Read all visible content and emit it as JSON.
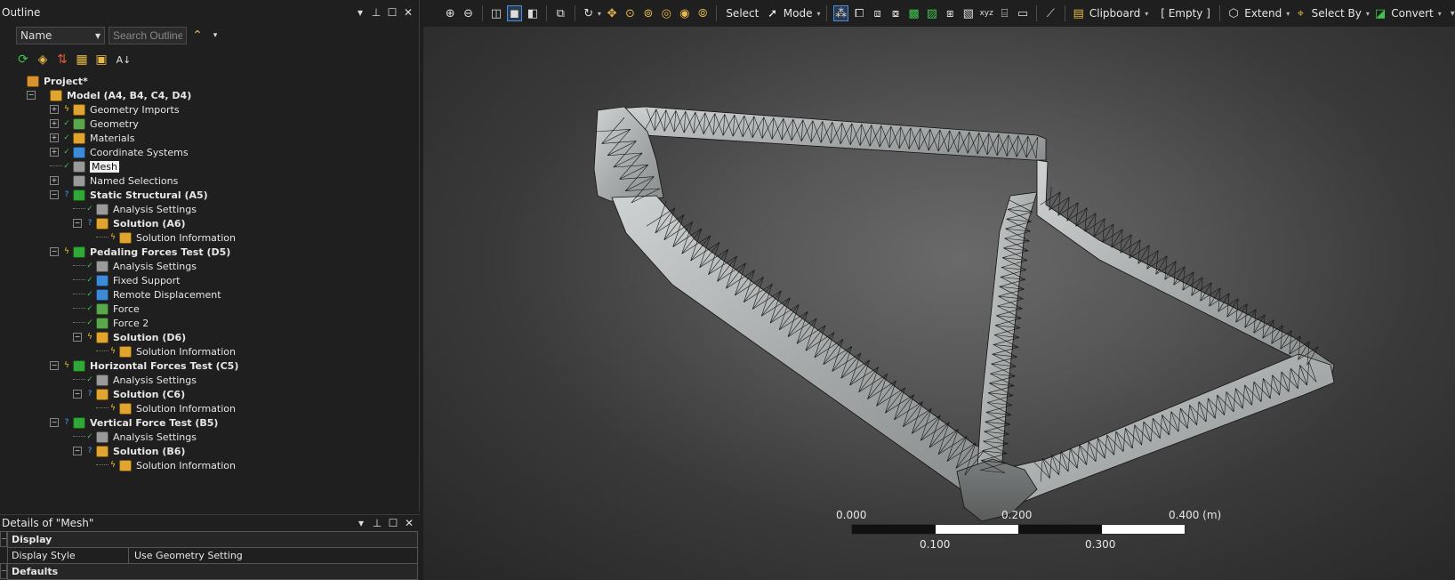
{
  "outline": {
    "title": "Outline",
    "controls": {
      "dropdown": "▾",
      "pin": "⊥",
      "restore": "☐",
      "close": "✕"
    },
    "name_select": "Name",
    "search_placeholder": "Search Outline",
    "tree": [
      {
        "label": "Project*",
        "bold": true,
        "depth": 0,
        "status": "",
        "expander": "",
        "icon_color": "#d8922e"
      },
      {
        "label": "Model (A4, B4, C4, D4)",
        "bold": true,
        "depth": 1,
        "status": "",
        "expander": "−",
        "icon_color": "#e0a42f"
      },
      {
        "label": "Geometry Imports",
        "bold": false,
        "depth": 2,
        "status": "bolt",
        "expander": "+",
        "icon_color": "#e0a42f"
      },
      {
        "label": "Geometry",
        "bold": false,
        "depth": 2,
        "status": "ok",
        "expander": "+",
        "icon_color": "#5aa84b"
      },
      {
        "label": "Materials",
        "bold": false,
        "depth": 2,
        "status": "ok",
        "expander": "+",
        "icon_color": "#e0a42f"
      },
      {
        "label": "Coordinate Systems",
        "bold": false,
        "depth": 2,
        "status": "ok",
        "expander": "+",
        "icon_color": "#3c8ad8"
      },
      {
        "label": "Mesh",
        "bold": false,
        "depth": 2,
        "status": "ok",
        "expander": "",
        "icon_color": "#9a9a9a",
        "selected": true
      },
      {
        "label": "Named Selections",
        "bold": false,
        "depth": 2,
        "status": "",
        "expander": "+",
        "icon_color": "#9a9a9a"
      },
      {
        "label": "Static Structural (A5)",
        "bold": true,
        "depth": 2,
        "status": "q",
        "expander": "−",
        "icon_color": "#2fa836"
      },
      {
        "label": "Analysis Settings",
        "bold": false,
        "depth": 3,
        "status": "ok",
        "expander": "",
        "icon_color": "#9a9a9a"
      },
      {
        "label": "Solution (A6)",
        "bold": true,
        "depth": 3,
        "status": "q",
        "expander": "−",
        "icon_color": "#e0a42f"
      },
      {
        "label": "Solution Information",
        "bold": false,
        "depth": 4,
        "status": "bolt",
        "expander": "",
        "icon_color": "#e0a42f"
      },
      {
        "label": "Pedaling Forces Test (D5)",
        "bold": true,
        "depth": 2,
        "status": "bolt",
        "expander": "−",
        "icon_color": "#2fa836"
      },
      {
        "label": "Analysis Settings",
        "bold": false,
        "depth": 3,
        "status": "ok",
        "expander": "",
        "icon_color": "#9a9a9a"
      },
      {
        "label": "Fixed Support",
        "bold": false,
        "depth": 3,
        "status": "ok",
        "expander": "",
        "icon_color": "#3c8ad8"
      },
      {
        "label": "Remote Displacement",
        "bold": false,
        "depth": 3,
        "status": "ok",
        "expander": "",
        "icon_color": "#3c8ad8"
      },
      {
        "label": "Force",
        "bold": false,
        "depth": 3,
        "status": "ok",
        "expander": "",
        "icon_color": "#5aa84b"
      },
      {
        "label": "Force 2",
        "bold": false,
        "depth": 3,
        "status": "ok",
        "expander": "",
        "icon_color": "#5aa84b"
      },
      {
        "label": "Solution (D6)",
        "bold": true,
        "depth": 3,
        "status": "bolt",
        "expander": "−",
        "icon_color": "#e0a42f"
      },
      {
        "label": "Solution Information",
        "bold": false,
        "depth": 4,
        "status": "bolt",
        "expander": "",
        "icon_color": "#e0a42f"
      },
      {
        "label": "Horizontal Forces Test (C5)",
        "bold": true,
        "depth": 2,
        "status": "bolt",
        "expander": "−",
        "icon_color": "#2fa836"
      },
      {
        "label": "Analysis Settings",
        "bold": false,
        "depth": 3,
        "status": "ok",
        "expander": "",
        "icon_color": "#9a9a9a"
      },
      {
        "label": "Solution (C6)",
        "bold": true,
        "depth": 3,
        "status": "q",
        "expander": "−",
        "icon_color": "#e0a42f"
      },
      {
        "label": "Solution Information",
        "bold": false,
        "depth": 4,
        "status": "bolt",
        "expander": "",
        "icon_color": "#e0a42f"
      },
      {
        "label": "Vertical Force Test (B5)",
        "bold": true,
        "depth": 2,
        "status": "q",
        "expander": "−",
        "icon_color": "#2fa836"
      },
      {
        "label": "Analysis Settings",
        "bold": false,
        "depth": 3,
        "status": "ok",
        "expander": "",
        "icon_color": "#9a9a9a"
      },
      {
        "label": "Solution (B6)",
        "bold": true,
        "depth": 3,
        "status": "q",
        "expander": "−",
        "icon_color": "#e0a42f"
      },
      {
        "label": "Solution Information",
        "bold": false,
        "depth": 4,
        "status": "bolt",
        "expander": "",
        "icon_color": "#e0a42f"
      }
    ]
  },
  "details": {
    "title": "Details of \"Mesh\"",
    "groups": {
      "display": "Display",
      "defaults": "Defaults"
    },
    "display_style_key": "Display Style",
    "display_style_value": "Use Geometry Setting"
  },
  "toolbar": {
    "select": "Select",
    "mode": "Mode",
    "clipboard": "Clipboard",
    "empty": "[ Empty ]",
    "extend": "Extend",
    "select_by": "Select By",
    "convert": "Convert"
  },
  "scale_bar": {
    "labels_top": [
      "0.000",
      "0.200",
      "0.400 (m)"
    ],
    "labels_bottom": [
      "0.100",
      "0.300"
    ]
  },
  "colors": {
    "accent": "#4a90d9",
    "ok": "#3cc24a",
    "unsolved": "#4aa3ff",
    "bolt": "#f2c230"
  }
}
